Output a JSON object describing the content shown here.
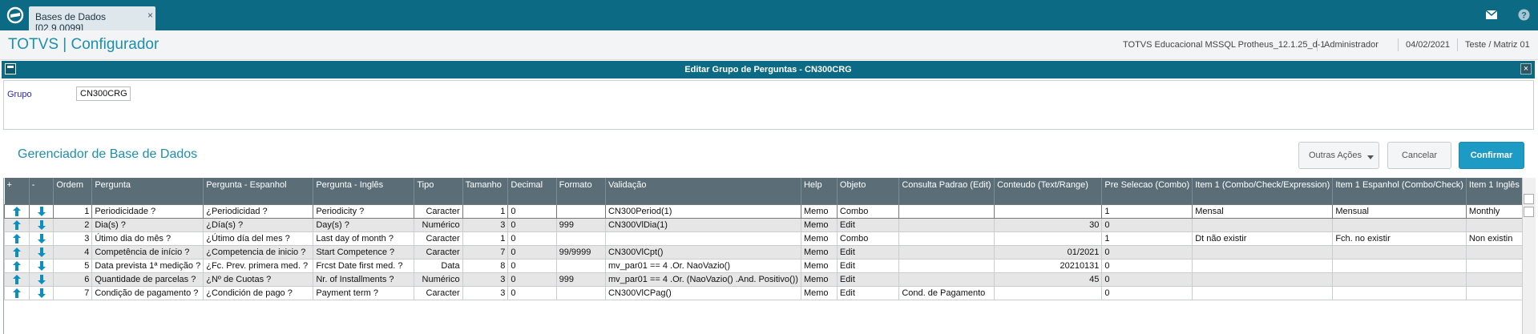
{
  "tab": {
    "label": "Bases de Dados [02.9.0099]",
    "close": "×"
  },
  "header": {
    "title": "TOTVS | Configurador",
    "environment": "TOTVS Educacional MSSQL Protheus_12.1.25_d-1",
    "user": "Administrador",
    "date": "04/02/2021",
    "company": "Teste / Matriz 01"
  },
  "dialog": {
    "title": "Editar Grupo de Perguntas - CN300CRG",
    "close": "×",
    "group_label": "Grupo",
    "group_value": "CN300CRG",
    "section_title": "Gerenciador de Base de Dados",
    "buttons": {
      "outras": "Outras Ações",
      "cancelar": "Cancelar",
      "confirmar": "Confirmar"
    }
  },
  "colors": {
    "accent": "#0d6a84",
    "brand_text": "#1e8fad",
    "confirm": "#1e9bc4",
    "grid_header": "#5b6e78",
    "arrow": "#0a8fc0"
  },
  "icons": {
    "move_up": "arrow-up-icon",
    "move_down": "arrow-down-icon",
    "logo": "totvs-logo-icon",
    "mail": "mail-icon",
    "help": "help-icon"
  },
  "grid": {
    "columns": [
      "+",
      "-",
      "Ordem",
      "Pergunta",
      "Pergunta - Espanhol",
      "Pergunta - Inglês",
      "Tipo",
      "Tamanho",
      "Decimal",
      "Formato",
      "Validação",
      "Help",
      "Objeto",
      "Consulta Padrao (Edit)",
      "Conteudo (Text/Range)",
      "Pre Selecao (Combo)",
      "Item 1 (Combo/Check/Expression)",
      "Item 1 Espanhol (Combo/Check)",
      "Item 1 Inglês"
    ],
    "rows": [
      [
        "1",
        "Periodicidade ?",
        "¿Periodicidad ?",
        "Periodicity ?",
        "Caracter",
        "1",
        "0",
        "",
        "CN300Period(1)",
        "Memo",
        "Combo",
        "",
        "",
        "1",
        "Mensal",
        "Mensual",
        "Monthly"
      ],
      [
        "2",
        "Dia(s) ?",
        "¿Día(s) ?",
        "Day(s) ?",
        "Numérico",
        "3",
        "0",
        "999",
        "CN300VlDia(1)",
        "Memo",
        "Edit",
        "",
        " 30",
        "0",
        "",
        "",
        ""
      ],
      [
        "3",
        "Útimo dia do mês ?",
        "¿Útimo día del mes ?",
        "Last day of month ?",
        "Caracter",
        "1",
        "0",
        "",
        "",
        "Memo",
        "Combo",
        "",
        "",
        "1",
        "Dt não existir",
        "Fch. no existir",
        "Non existin"
      ],
      [
        "4",
        "Competência de início ?",
        "¿Competencia de inicio ?",
        "Start Competence ?",
        "Caracter",
        "7",
        "0",
        "99/9999",
        "CN300VlCpt()",
        "Memo",
        "Edit",
        "",
        "01/2021",
        "0",
        "",
        "",
        ""
      ],
      [
        "5",
        "Data prevista 1ª medição ?",
        "¿Fc. Prev. primera med. ?",
        "Frcst Date first med. ?",
        "Data",
        "8",
        "0",
        "",
        "mv_par01 == 4 .Or. NaoVazio()",
        "Memo",
        "Edit",
        "",
        "20210131",
        "0",
        "",
        "",
        ""
      ],
      [
        "6",
        "Quantidade de parcelas ?",
        "¿Nº de Cuotas ?",
        "Nr. of Installments ?",
        "Numérico",
        "3",
        "0",
        "999",
        "mv_par01 == 4 .Or. (NaoVazio() .And. Positivo())",
        "Memo",
        "Edit",
        "",
        " 45",
        "0",
        "",
        "",
        ""
      ],
      [
        "7",
        "Condição de pagamento ?",
        "¿Condición de pago ?",
        "Payment term ?",
        "Caracter",
        "3",
        "0",
        "",
        "CN300VlCPag()",
        "Memo",
        "Edit",
        "Cond. de Pagamento",
        "",
        "0",
        "",
        "",
        ""
      ]
    ]
  }
}
